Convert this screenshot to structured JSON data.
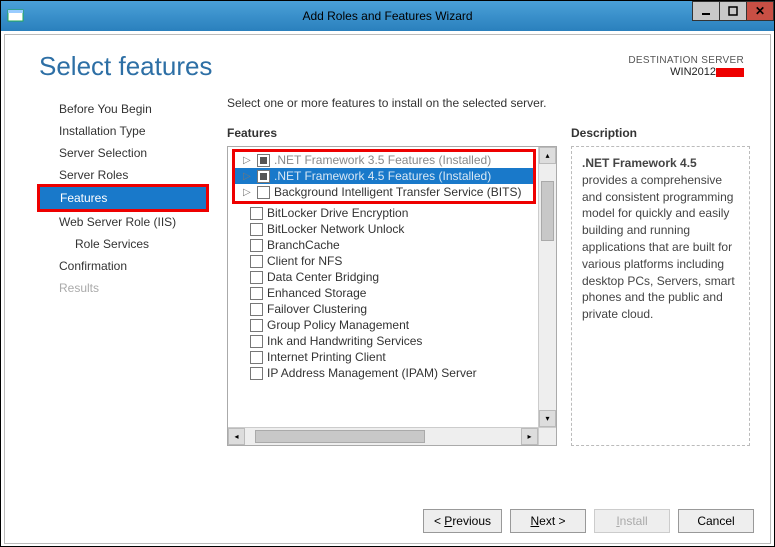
{
  "window": {
    "title": "Add Roles and Features Wizard"
  },
  "header": {
    "page_title": "Select features",
    "dest_label": "DESTINATION SERVER",
    "dest_server": "WIN2012"
  },
  "nav": {
    "items": [
      {
        "label": "Before You Begin",
        "active": false,
        "disabled": false,
        "sub": false,
        "highlighted": false
      },
      {
        "label": "Installation Type",
        "active": false,
        "disabled": false,
        "sub": false,
        "highlighted": false
      },
      {
        "label": "Server Selection",
        "active": false,
        "disabled": false,
        "sub": false,
        "highlighted": false
      },
      {
        "label": "Server Roles",
        "active": false,
        "disabled": false,
        "sub": false,
        "highlighted": false
      },
      {
        "label": "Features",
        "active": true,
        "disabled": false,
        "sub": false,
        "highlighted": true
      },
      {
        "label": "Web Server Role (IIS)",
        "active": false,
        "disabled": false,
        "sub": false,
        "highlighted": false
      },
      {
        "label": "Role Services",
        "active": false,
        "disabled": false,
        "sub": true,
        "highlighted": false
      },
      {
        "label": "Confirmation",
        "active": false,
        "disabled": false,
        "sub": false,
        "highlighted": false
      },
      {
        "label": "Results",
        "active": false,
        "disabled": true,
        "sub": false,
        "highlighted": false
      }
    ]
  },
  "main": {
    "instruction": "Select one or more features to install on the selected server.",
    "features_heading": "Features",
    "description_heading": "Description",
    "features": [
      {
        "label": ".NET Framework 3.5 Features (Installed)",
        "expandable": true,
        "checkbox": "partial",
        "greyed": true,
        "selected": false,
        "in_red_group": true
      },
      {
        "label": ".NET Framework 4.5 Features (Installed)",
        "expandable": true,
        "checkbox": "partial",
        "greyed": true,
        "selected": true,
        "in_red_group": true
      },
      {
        "label": "Background Intelligent Transfer Service (BITS)",
        "expandable": true,
        "checkbox": "unchecked",
        "greyed": false,
        "selected": false,
        "in_red_group": true
      },
      {
        "label": "BitLocker Drive Encryption",
        "expandable": false,
        "checkbox": "unchecked",
        "greyed": false,
        "selected": false,
        "in_red_group": false
      },
      {
        "label": "BitLocker Network Unlock",
        "expandable": false,
        "checkbox": "unchecked",
        "greyed": false,
        "selected": false,
        "in_red_group": false
      },
      {
        "label": "BranchCache",
        "expandable": false,
        "checkbox": "unchecked",
        "greyed": false,
        "selected": false,
        "in_red_group": false
      },
      {
        "label": "Client for NFS",
        "expandable": false,
        "checkbox": "unchecked",
        "greyed": false,
        "selected": false,
        "in_red_group": false
      },
      {
        "label": "Data Center Bridging",
        "expandable": false,
        "checkbox": "unchecked",
        "greyed": false,
        "selected": false,
        "in_red_group": false
      },
      {
        "label": "Enhanced Storage",
        "expandable": false,
        "checkbox": "unchecked",
        "greyed": false,
        "selected": false,
        "in_red_group": false
      },
      {
        "label": "Failover Clustering",
        "expandable": false,
        "checkbox": "unchecked",
        "greyed": false,
        "selected": false,
        "in_red_group": false
      },
      {
        "label": "Group Policy Management",
        "expandable": false,
        "checkbox": "unchecked",
        "greyed": false,
        "selected": false,
        "in_red_group": false
      },
      {
        "label": "Ink and Handwriting Services",
        "expandable": false,
        "checkbox": "unchecked",
        "greyed": false,
        "selected": false,
        "in_red_group": false
      },
      {
        "label": "Internet Printing Client",
        "expandable": false,
        "checkbox": "unchecked",
        "greyed": false,
        "selected": false,
        "in_red_group": false
      },
      {
        "label": "IP Address Management (IPAM) Server",
        "expandable": false,
        "checkbox": "unchecked",
        "greyed": false,
        "selected": false,
        "in_red_group": false
      }
    ],
    "description": {
      "name": ".NET Framework 4.5",
      "body": " provides a comprehensive and consistent programming model for quickly and easily building and running applications that are built for various platforms including desktop PCs, Servers, smart phones and the public and private cloud."
    }
  },
  "buttons": {
    "previous": "< Previous",
    "next": "Next >",
    "install": "Install",
    "cancel": "Cancel"
  }
}
